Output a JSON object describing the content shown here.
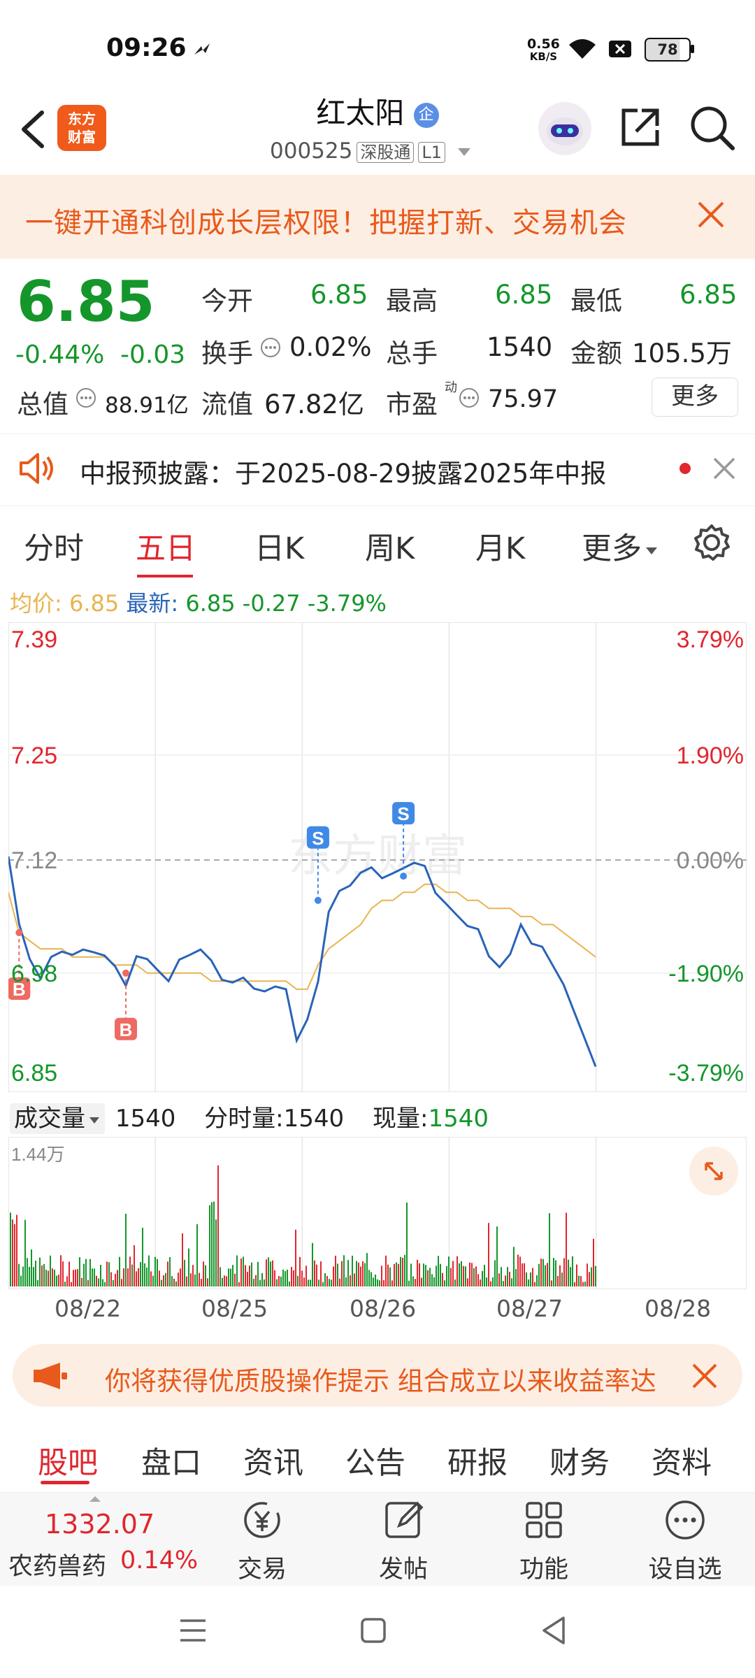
{
  "status_bar": {
    "time": "09:26",
    "net_speed_value": "0.56",
    "net_speed_unit": "KB/S",
    "battery": "78"
  },
  "header": {
    "logo_text_line1": "东方",
    "logo_text_line2": "财富",
    "stock_name": "红太阳",
    "badge": "企",
    "stock_code": "000525",
    "connect_tag": "深股通",
    "level_tag": "L1"
  },
  "banner": {
    "text": "一键开通科创成长层权限！把握打新、交易机会"
  },
  "quote": {
    "price": "6.85",
    "change_pct": "-0.44%",
    "change_abs": "-0.03",
    "stats": {
      "open_label": "今开",
      "open": "6.85",
      "high_label": "最高",
      "high": "6.85",
      "low_label": "最低",
      "low": "6.85",
      "turnover_label": "换手",
      "turnover": "0.02%",
      "volume_label": "总手",
      "volume": "1540",
      "amount_label": "金额",
      "amount": "105.5万",
      "mktcap_label": "总值",
      "mktcap": "88.91亿",
      "float_label": "流值",
      "float": "67.82亿",
      "pe_label": "市盈",
      "pe_sup": "动",
      "pe": "75.97"
    },
    "more_label": "更多"
  },
  "notice": {
    "text": "中报预披露：于2025-08-29披露2025年中报"
  },
  "chart_tabs": [
    "分时",
    "五日",
    "日K",
    "周K",
    "月K",
    "更多"
  ],
  "chart_tab_active": "五日",
  "avg_line": {
    "avg_label": "均价:",
    "avg_value": "6.85",
    "latest_label": "最新:",
    "latest_value": "6.85",
    "change": "-0.27",
    "change_pct": "-3.79%"
  },
  "chart_data": {
    "type": "line",
    "title": "",
    "x_dates": [
      "08/22",
      "08/25",
      "08/26",
      "08/27",
      "08/28"
    ],
    "y_ticks": [
      "7.39",
      "7.25",
      "7.12",
      "6.98",
      "6.85"
    ],
    "y_pct_ticks": [
      "3.79%",
      "1.90%",
      "0.00%",
      "-1.90%",
      "-3.79%"
    ],
    "ylim": [
      6.85,
      7.39
    ],
    "prev_close": 7.12,
    "watermark": "东方财富",
    "series": [
      {
        "name": "price",
        "color": "#2a63b8",
        "values": [
          7.12,
          7.04,
          7.0,
          6.97,
          7.0,
          7.01,
          7.0,
          7.01,
          7.01,
          7.0,
          6.99,
          6.96,
          7.0,
          7.0,
          6.98,
          6.97,
          7.0,
          7.0,
          7.01,
          7.0,
          6.97,
          6.97,
          6.97,
          6.96,
          6.96,
          6.96,
          6.96,
          6.9,
          6.92,
          6.97,
          7.06,
          7.08,
          7.09,
          7.1,
          7.11,
          7.1,
          7.1,
          7.11,
          7.12,
          7.11,
          7.08,
          7.07,
          7.05,
          7.04,
          7.03,
          7.0,
          6.99,
          7.0,
          7.04,
          7.02,
          7.01,
          6.99,
          6.97,
          6.93,
          6.9,
          6.86
        ]
      },
      {
        "name": "avg",
        "color": "#e8b450",
        "values": [
          7.08,
          7.03,
          7.02,
          7.01,
          7.01,
          7.01,
          7.0,
          7.0,
          7.0,
          7.0,
          6.99,
          6.99,
          6.99,
          6.98,
          6.98,
          6.98,
          6.98,
          6.98,
          6.98,
          6.97,
          6.97,
          6.97,
          6.97,
          6.97,
          6.97,
          6.97,
          6.97,
          6.96,
          6.96,
          6.99,
          7.01,
          7.02,
          7.03,
          7.04,
          7.06,
          7.07,
          7.07,
          7.08,
          7.08,
          7.09,
          7.09,
          7.08,
          7.08,
          7.07,
          7.07,
          7.06,
          7.06,
          7.06,
          7.05,
          7.05,
          7.04,
          7.04,
          7.03,
          7.02,
          7.01,
          7.0
        ]
      }
    ],
    "markers": [
      {
        "label": "B",
        "type": "buy",
        "x_index": 1,
        "price": 7.03
      },
      {
        "label": "B",
        "type": "buy",
        "x_index": 11,
        "price": 6.98
      },
      {
        "label": "S",
        "type": "sell",
        "x_index": 29,
        "price": 7.07
      },
      {
        "label": "S",
        "type": "sell",
        "x_index": 37,
        "price": 7.1
      }
    ]
  },
  "volume": {
    "selector_label": "成交量",
    "total": "1540",
    "tick_label": "分时量:",
    "tick_value": "1540",
    "current_label": "现量:",
    "current_value": "1540",
    "max_label": "1.44万"
  },
  "promo": {
    "text": "你将获得优质股操作提示 组合成立以来收益率达"
  },
  "bottom_tabs": [
    "股吧",
    "盘口",
    "资讯",
    "公告",
    "研报",
    "财务",
    "资料"
  ],
  "bottom_tab_active": "股吧",
  "bottom_bar": {
    "index_value": "1332.07",
    "index_name": "农药兽药",
    "index_change": "0.14%",
    "items": [
      "交易",
      "发帖",
      "功能",
      "设自选"
    ]
  },
  "colors": {
    "up": "#e0262e",
    "down": "#14962b",
    "accent": "#e85a1b",
    "line": "#2a63b8",
    "avg": "#e8b450"
  }
}
